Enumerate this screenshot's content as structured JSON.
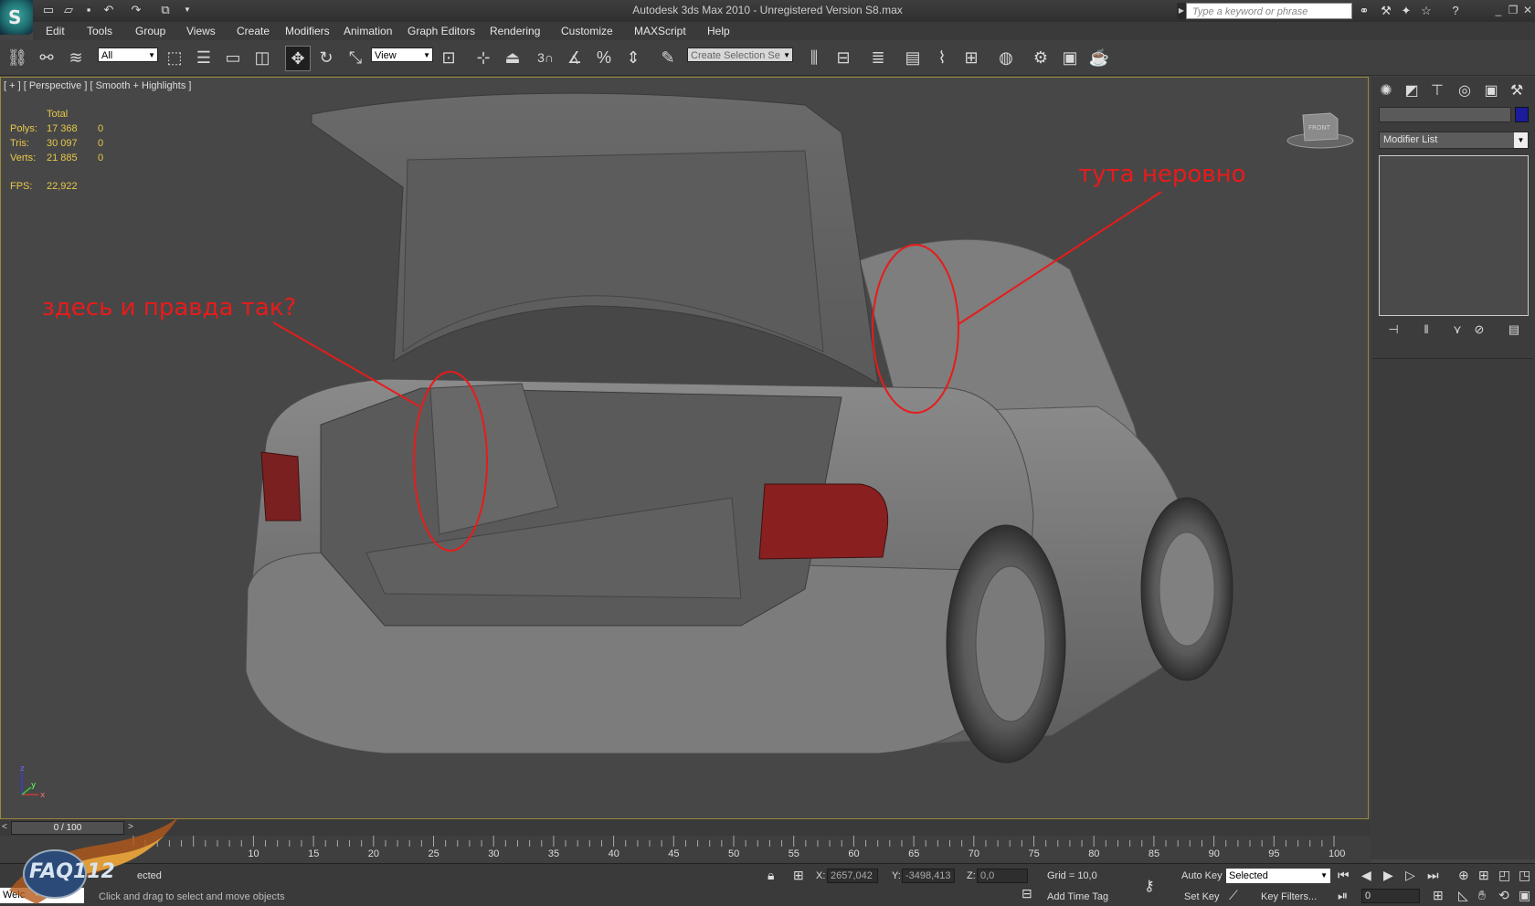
{
  "window": {
    "title": "Autodesk 3ds Max  2010    - Unregistered Version     S8.max",
    "search_placeholder": "Type a keyword or phrase"
  },
  "menu": [
    "Edit",
    "Tools",
    "Group",
    "Views",
    "Create",
    "Modifiers",
    "Animation",
    "Graph Editors",
    "Rendering",
    "Customize",
    "MAXScript",
    "Help"
  ],
  "toolbar": {
    "filter_value": "All",
    "ref_coord_value": "View",
    "snap_label": "3",
    "selection_set_placeholder": "Create Selection Se"
  },
  "viewport": {
    "label": "[ + ] [ Perspective ] [ Smooth + Highlights ]",
    "stats": {
      "total_header": "Total",
      "polys_label": "Polys:",
      "polys_total": "17 368",
      "polys_sel": "0",
      "tris_label": "Tris:",
      "tris_total": "30 097",
      "tris_sel": "0",
      "verts_label": "Verts:",
      "verts_total": "21 885",
      "verts_sel": "0",
      "fps_label": "FPS:",
      "fps_value": "22,922"
    },
    "viewcube_label": "FRONT",
    "axis_z": "z",
    "axis_x": "x",
    "axis_y": "y"
  },
  "annotations": {
    "left": "здесь и правда так?",
    "right": "тута неровно",
    "color": "#e81b1b"
  },
  "command_panel": {
    "modifier_list": "Modifier List",
    "object_color": "#1b1b9c"
  },
  "time": {
    "slider_value": "0 / 100",
    "ticks": [
      "10",
      "15",
      "20",
      "25",
      "30",
      "35",
      "40",
      "45",
      "50",
      "55",
      "60",
      "65",
      "70",
      "75",
      "80",
      "85",
      "90",
      "95",
      "100"
    ]
  },
  "status": {
    "selected_text": "ected",
    "prompt_left": "Welc",
    "prompt": "Click and drag to select and move objects",
    "x_label": "X:",
    "x_value": "2657,042",
    "y_label": "Y:",
    "y_value": "-3498,413",
    "z_label": "Z:",
    "z_value": "0,0",
    "grid": "Grid = 10,0",
    "add_time_tag": "Add Time Tag",
    "auto_key": "Auto Key",
    "set_key": "Set Key",
    "key_mode_value": "Selected",
    "key_filters": "Key Filters...",
    "frame_value": "0"
  },
  "watermark": "FAQ112"
}
